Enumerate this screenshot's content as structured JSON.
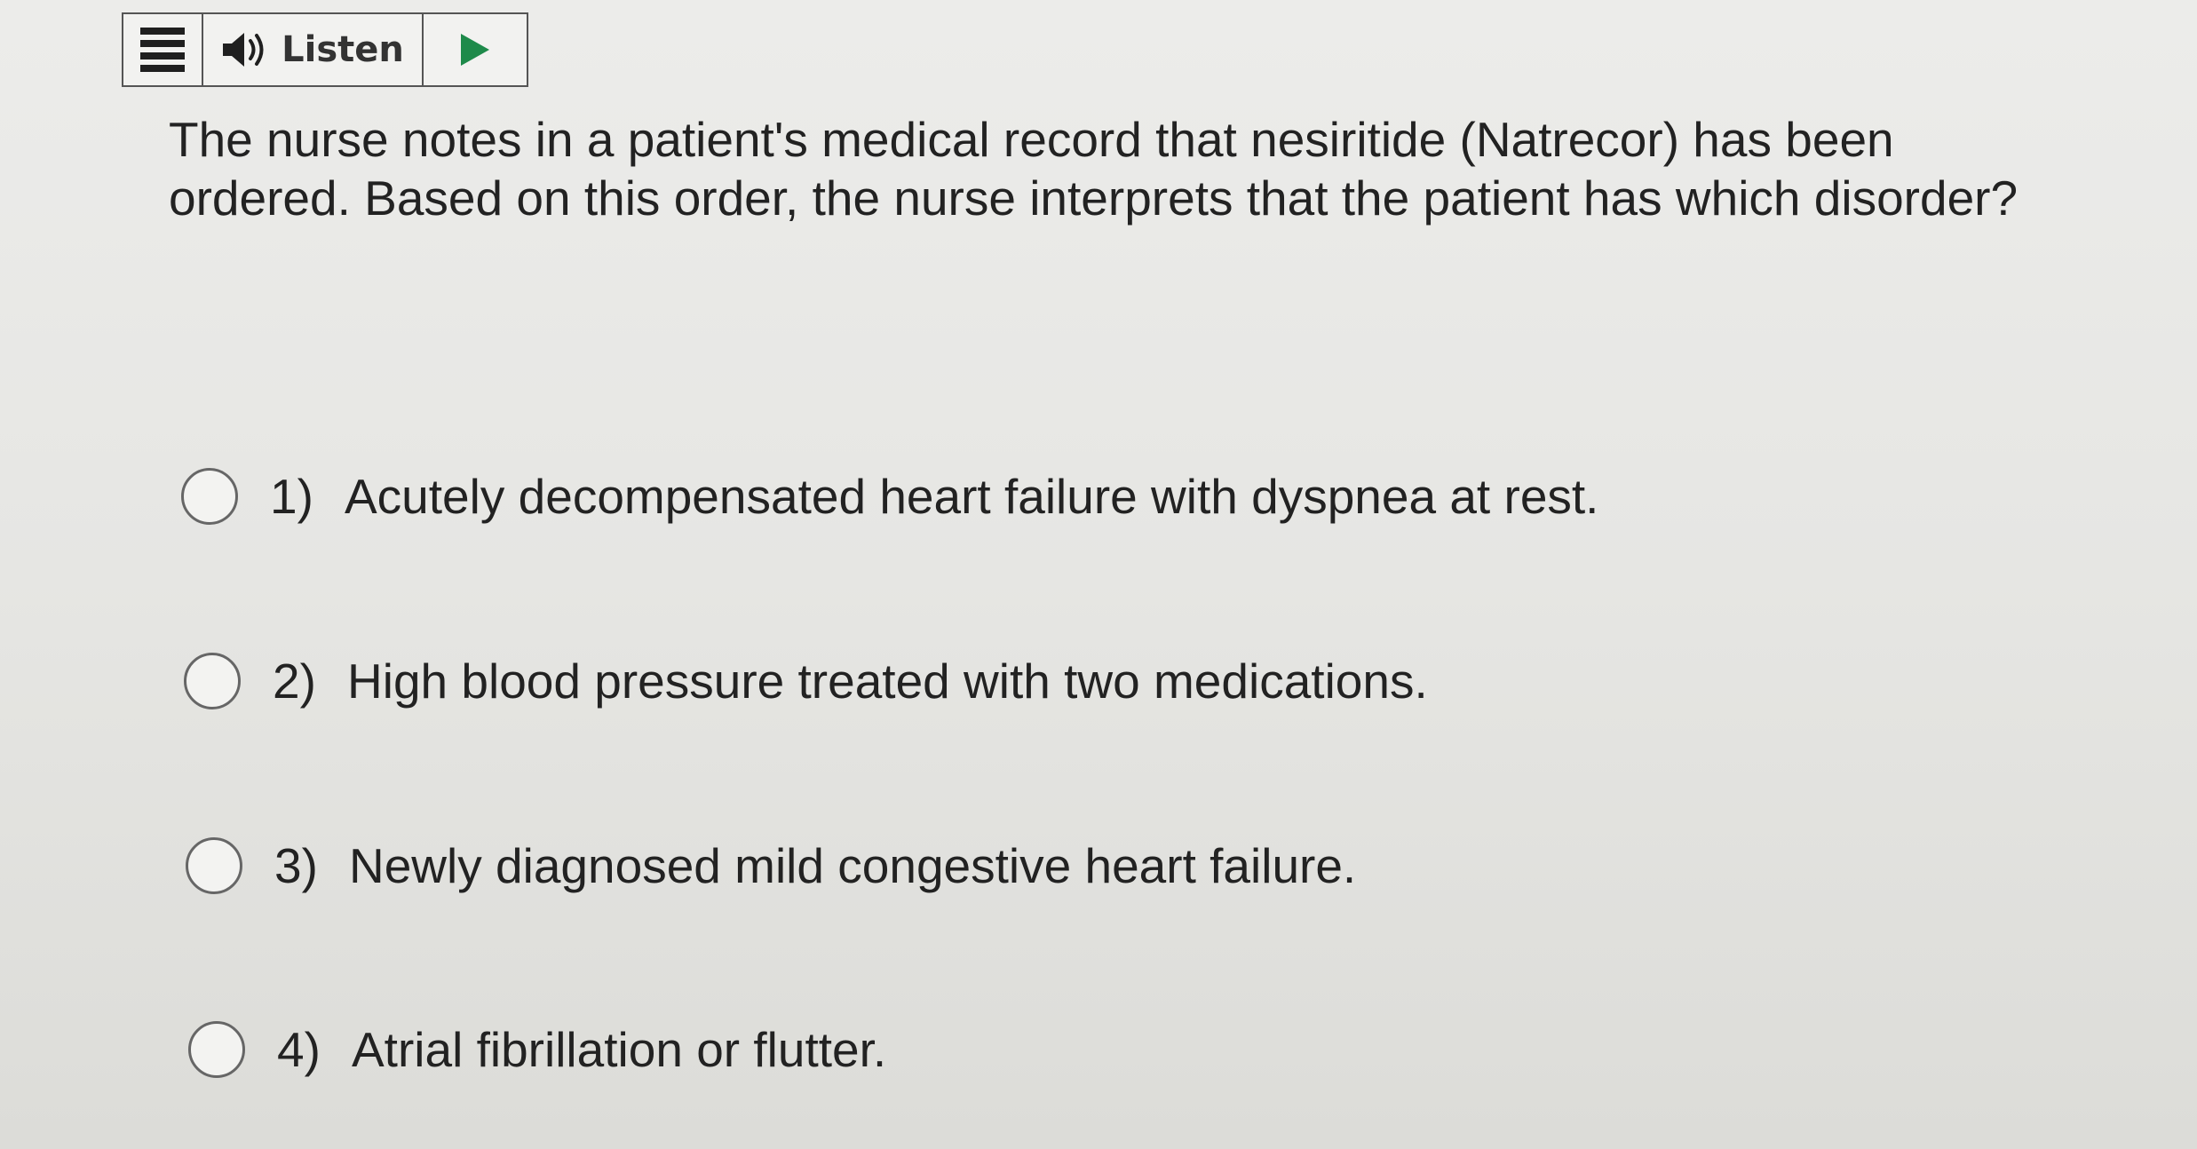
{
  "toolbar": {
    "menu_icon": "hamburger-menu-icon",
    "speaker_icon": "speaker-icon",
    "listen_label": "Listen",
    "play_icon": "play-icon"
  },
  "question": {
    "text": "The nurse notes in a patient's medical record that nesiritide (Natrecor) has been ordered. Based on this order, the nurse interprets that the patient has which disorder?"
  },
  "options": [
    {
      "number": "1)",
      "text": "Acutely decompensated heart failure with dyspnea at rest."
    },
    {
      "number": "2)",
      "text": "High blood pressure treated with two medications."
    },
    {
      "number": "3)",
      "text": "Newly diagnosed mild congestive heart failure."
    },
    {
      "number": "4)",
      "text": "Atrial fibrillation or flutter."
    }
  ],
  "colors": {
    "background": "#e6e6e3",
    "text": "#222222",
    "play_green": "#1e8a4a"
  }
}
